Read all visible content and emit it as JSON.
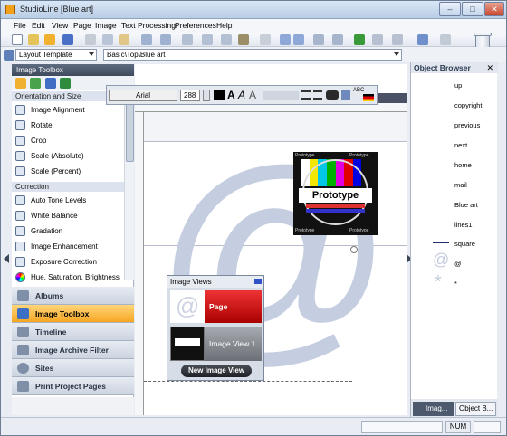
{
  "window": {
    "title": "StudioLine [Blue art]",
    "minimize": "–",
    "maximize": "□",
    "close": "✕"
  },
  "menu": [
    "File",
    "Edit",
    "View",
    "Page",
    "Image",
    "Text Processing",
    "Preferences",
    "Help"
  ],
  "toolbar2": {
    "template_combo": "Layout Template",
    "path_combo": "Basic\\Top\\Blue art"
  },
  "left_panel": {
    "title": "Image Toolbox",
    "section1": "Orientation and Size",
    "items1": [
      "Image Alignment",
      "Rotate",
      "Crop",
      "Scale (Absolute)",
      "Scale (Percent)"
    ],
    "section2": "Correction",
    "items2": [
      "Auto Tone Levels",
      "White Balance",
      "Gradation",
      "Image Enhancement",
      "Exposure Correction",
      "Hue, Saturation, Brightness"
    ],
    "nav": [
      "Albums",
      "Image Toolbox",
      "Timeline",
      "Image Archive Filter",
      "Sites",
      "Print Project Pages"
    ]
  },
  "format_bar": {
    "font": "Arial",
    "size": "288",
    "language_flag": "ABC"
  },
  "prototype": {
    "label": "Prototype",
    "tiny": "Prototype"
  },
  "image_views": {
    "title": "Image Views",
    "tile1": "Page",
    "tile2": "Image View 1",
    "button": "New Image View"
  },
  "right_panel": {
    "title": "Object Browser",
    "items": [
      "up",
      "copyright",
      "previous",
      "next",
      "home",
      "mail",
      "Blue art",
      "lines1",
      "square",
      "@",
      "*"
    ],
    "tab1": "Imag...",
    "tab2": "Object B..."
  },
  "status": {
    "num": "NUM"
  },
  "colors": {
    "accent": "#f6a623",
    "bars": [
      "#ffffff",
      "#f3e600",
      "#00c7e6",
      "#00b000",
      "#e000e0",
      "#e00000",
      "#0000e0",
      "#111111"
    ]
  }
}
